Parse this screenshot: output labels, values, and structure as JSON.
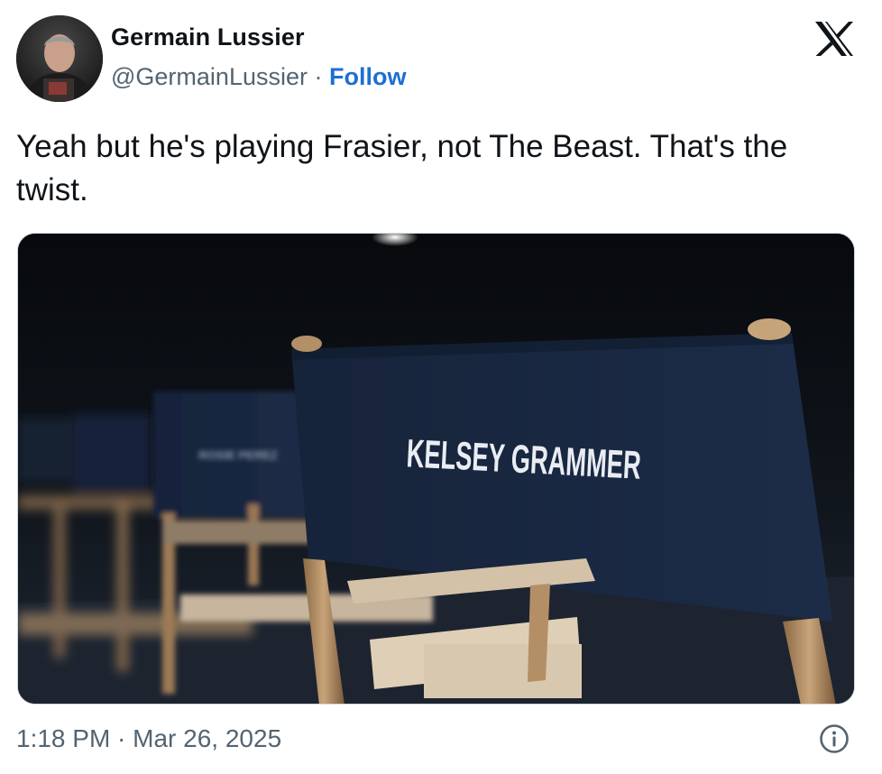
{
  "author": {
    "display_name": "Germain Lussier",
    "handle": "@GermainLussier",
    "separator": "·",
    "follow_label": "Follow"
  },
  "tweet": {
    "text": "Yeah but he's playing Frasier, not The Beast. That's the twist."
  },
  "media": {
    "chair_label_main": "KELSEY GRAMMER",
    "chair_label_second": "ROSIE PEREZ"
  },
  "footer": {
    "timestamp": "1:18 PM · Mar 26, 2025"
  },
  "icons": {
    "platform_logo": "x-logo-icon",
    "info": "info-icon"
  },
  "colors": {
    "text_primary": "#0f1419",
    "text_secondary": "#536471",
    "link": "#1d6fd0",
    "border": "#cfd9de"
  }
}
